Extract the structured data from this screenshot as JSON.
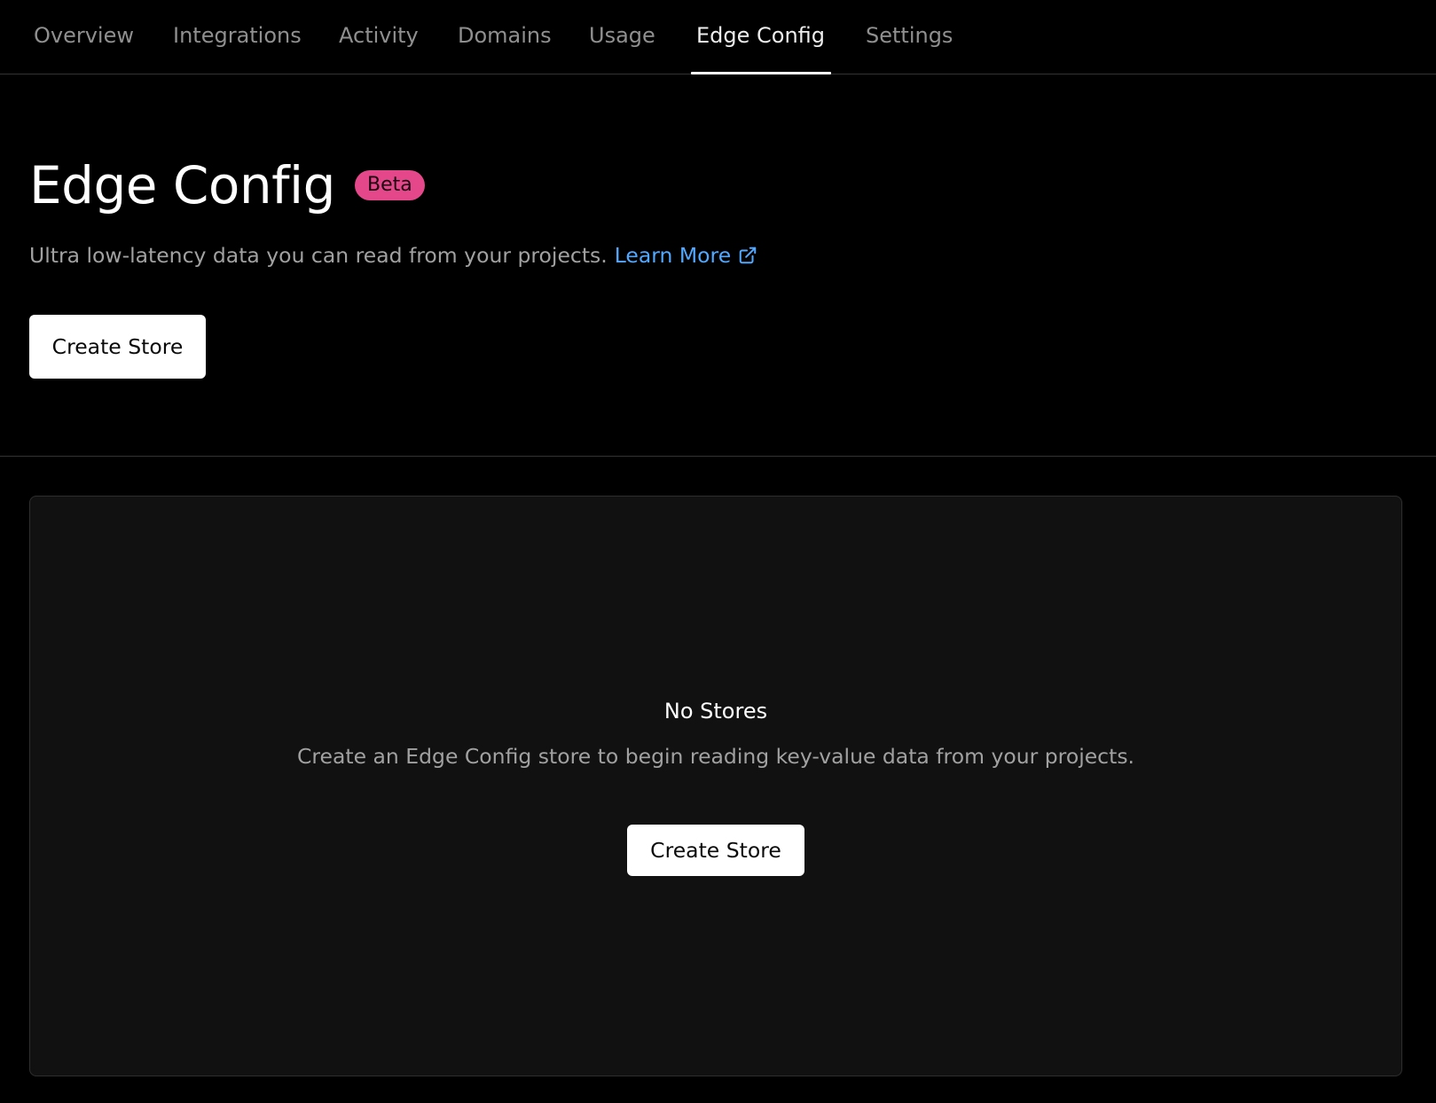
{
  "tabs": [
    {
      "label": "Overview",
      "active": false
    },
    {
      "label": "Integrations",
      "active": false
    },
    {
      "label": "Activity",
      "active": false
    },
    {
      "label": "Domains",
      "active": false
    },
    {
      "label": "Usage",
      "active": false
    },
    {
      "label": "Edge Config",
      "active": true
    },
    {
      "label": "Settings",
      "active": false
    }
  ],
  "header": {
    "title": "Edge Config",
    "badge": "Beta",
    "subtitle": "Ultra low-latency data you can read from your projects.",
    "learn_more_label": "Learn More",
    "learn_more_icon": "external-link-icon",
    "create_button_label": "Create Store"
  },
  "empty_state": {
    "title": "No Stores",
    "description": "Create an Edge Config store to begin reading key-value data from your projects.",
    "create_button_label": "Create Store"
  },
  "colors": {
    "background": "#000000",
    "card_background": "#111111",
    "badge": "#e5488a",
    "link": "#52a8ff",
    "border": "#333333"
  }
}
